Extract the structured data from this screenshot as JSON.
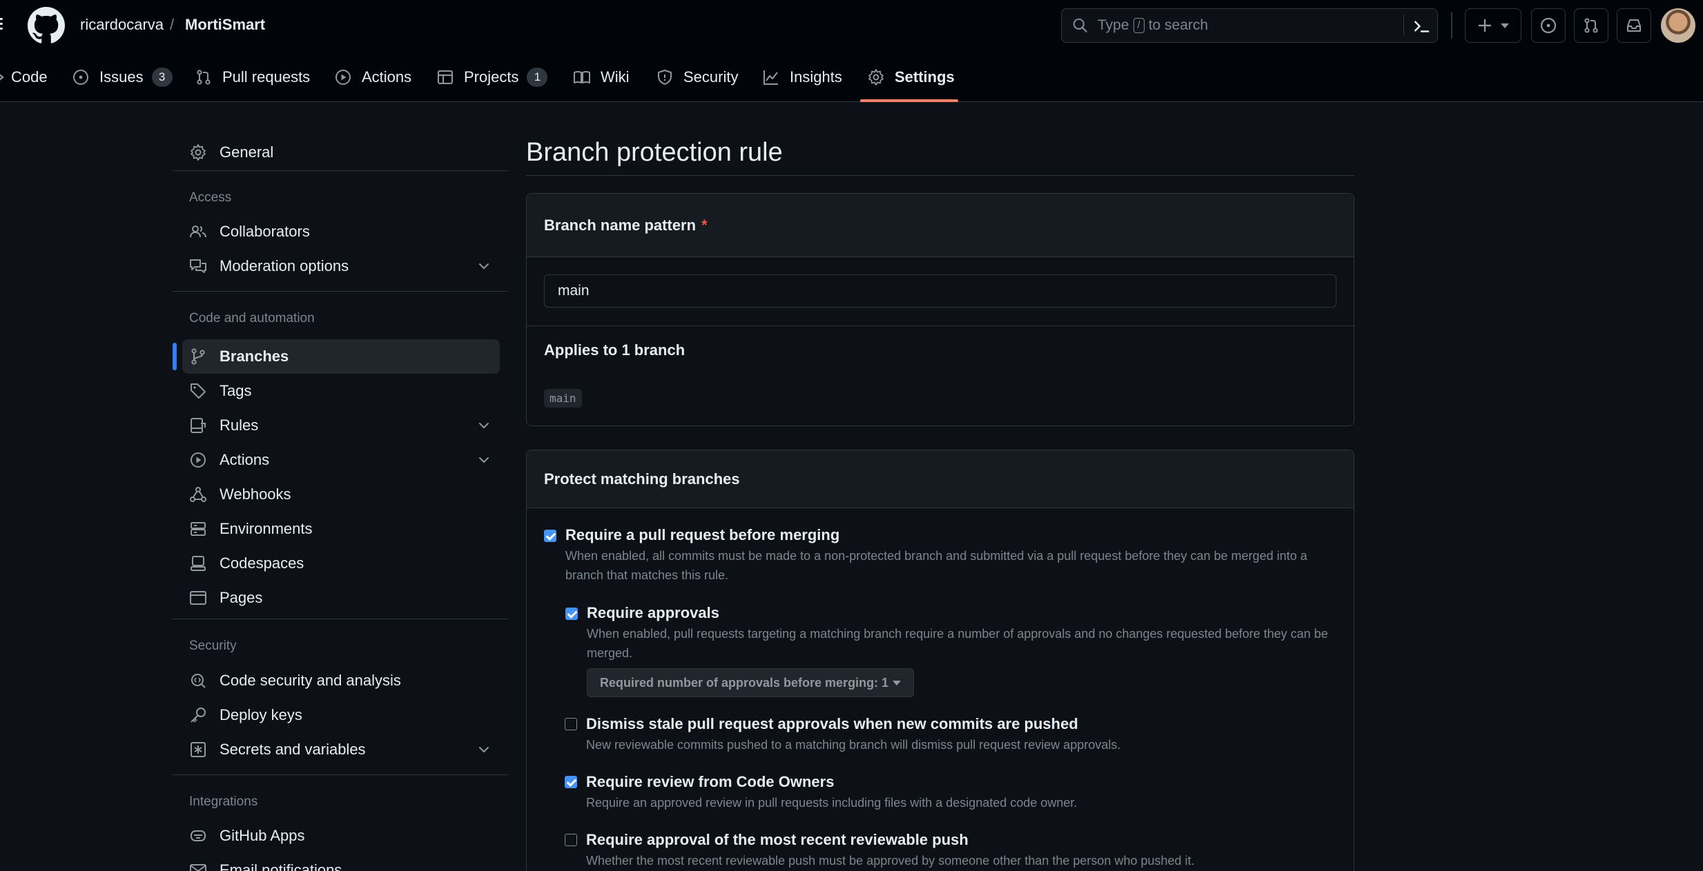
{
  "header": {
    "owner": "ricardocarva",
    "separator": "/",
    "repo": "MortiSmart",
    "search": {
      "before_key": "Type",
      "key": "/",
      "after_key": "to search"
    }
  },
  "tabs": [
    {
      "label": "Code",
      "icon": "code-icon"
    },
    {
      "label": "Issues",
      "icon": "issue-icon",
      "count": "3"
    },
    {
      "label": "Pull requests",
      "icon": "pull-request-icon"
    },
    {
      "label": "Actions",
      "icon": "play-icon"
    },
    {
      "label": "Projects",
      "icon": "table-icon",
      "count": "1"
    },
    {
      "label": "Wiki",
      "icon": "book-icon"
    },
    {
      "label": "Security",
      "icon": "shield-icon"
    },
    {
      "label": "Insights",
      "icon": "graph-icon"
    },
    {
      "label": "Settings",
      "icon": "gear-icon",
      "active": true
    }
  ],
  "sidebar": {
    "general": "General",
    "sections": {
      "access": "Access",
      "code_automation": "Code and automation",
      "security": "Security",
      "integrations": "Integrations"
    },
    "items": {
      "collaborators": "Collaborators",
      "moderation": "Moderation options",
      "branches": "Branches",
      "tags": "Tags",
      "rules": "Rules",
      "actions": "Actions",
      "webhooks": "Webhooks",
      "environments": "Environments",
      "codespaces": "Codespaces",
      "pages": "Pages",
      "code_security": "Code security and analysis",
      "deploy_keys": "Deploy keys",
      "secrets": "Secrets and variables",
      "github_apps": "GitHub Apps",
      "email_notifications": "Email notifications"
    }
  },
  "main": {
    "title": "Branch protection rule",
    "pattern_label": "Branch name pattern",
    "required_marker": "*",
    "pattern_value": "main",
    "applies_text": "Applies to 1 branch",
    "matched_branch": "main",
    "protect_header": "Protect matching branches",
    "rules": {
      "require_pr": {
        "title": "Require a pull request before merging",
        "desc": "When enabled, all commits must be made to a non-protected branch and submitted via a pull request before they can be merged into a branch that matches this rule.",
        "checked": true
      },
      "require_approvals": {
        "title": "Require approvals",
        "desc": "When enabled, pull requests targeting a matching branch require a number of approvals and no changes requested before they can be merged.",
        "checked": true,
        "select_label": "Required number of approvals before merging: 1"
      },
      "dismiss_stale": {
        "title": "Dismiss stale pull request approvals when new commits are pushed",
        "desc": "New reviewable commits pushed to a matching branch will dismiss pull request review approvals.",
        "checked": false
      },
      "code_owners": {
        "title": "Require review from Code Owners",
        "desc": "Require an approved review in pull requests including files with a designated code owner.",
        "checked": true
      },
      "recent_push": {
        "title": "Require approval of the most recent reviewable push",
        "desc": "Whether the most recent reviewable push must be approved by someone other than the person who pushed it.",
        "checked": false
      }
    }
  }
}
